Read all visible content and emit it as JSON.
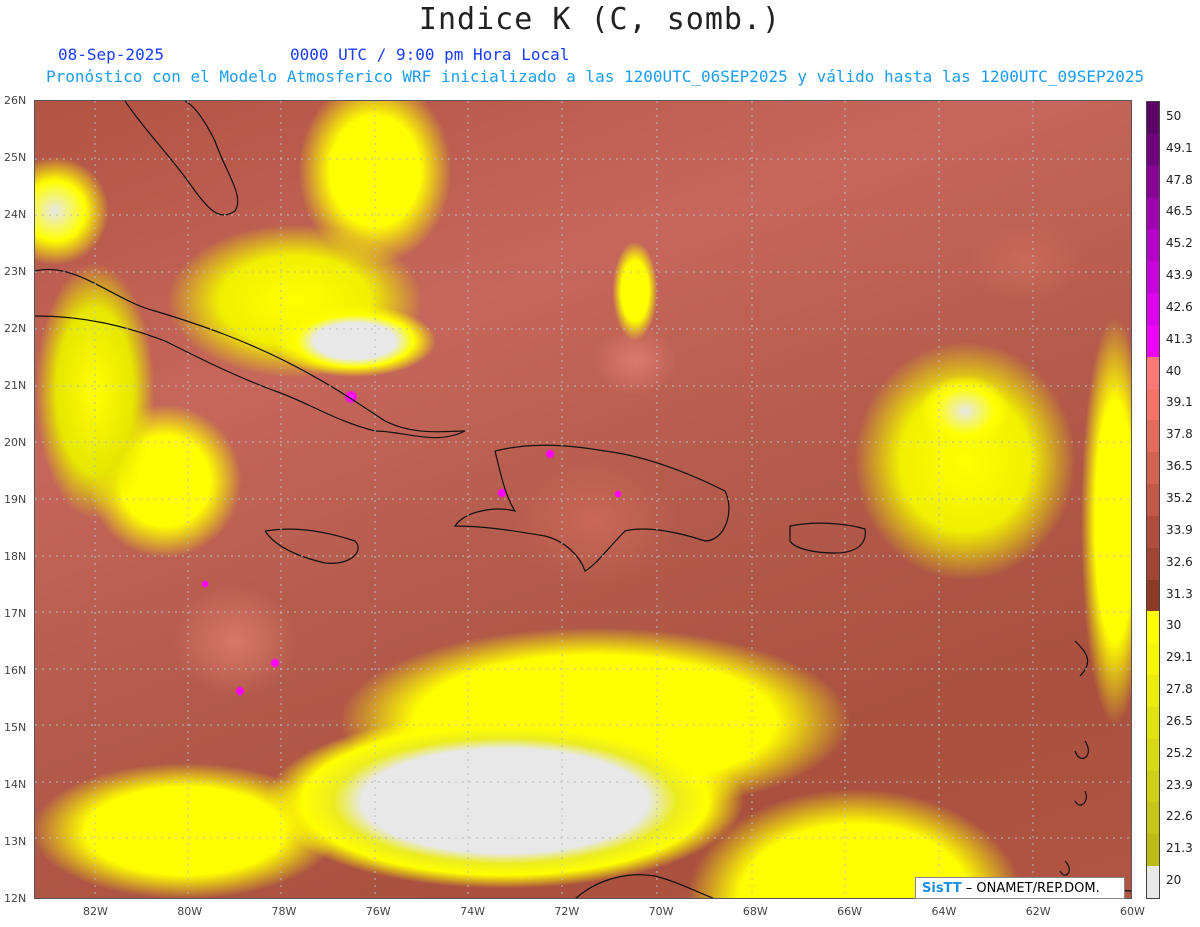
{
  "header": {
    "title": "Indice K (C, somb.)",
    "date": "08-Sep-2025",
    "time": "0000 UTC / 9:00 pm Hora Local",
    "model_line": "Pronóstico con el Modelo Atmosferico WRF inicializado a las 1200UTC_06SEP2025 y válido hasta las  1200UTC_09SEP2025"
  },
  "axes": {
    "lat_labels": [
      "26N",
      "25N",
      "24N",
      "23N",
      "22N",
      "21N",
      "20N",
      "19N",
      "18N",
      "17N",
      "16N",
      "15N",
      "14N",
      "13N",
      "12N"
    ],
    "lon_labels": [
      "82W",
      "80W",
      "78W",
      "76W",
      "74W",
      "72W",
      "70W",
      "68W",
      "66W",
      "64W",
      "62W",
      "60W"
    ]
  },
  "colorbar": {
    "labels": [
      "50",
      "49.1",
      "47.8",
      "46.5",
      "45.2",
      "43.9",
      "42.6",
      "41.3",
      "40",
      "39.1",
      "37.8",
      "36.5",
      "35.2",
      "33.9",
      "32.6",
      "31.3",
      "30",
      "29.1",
      "27.8",
      "26.5",
      "25.2",
      "23.9",
      "22.6",
      "21.3",
      "20"
    ],
    "colors": [
      "#5a0066",
      "#70007e",
      "#8a0096",
      "#a000b0",
      "#b400c8",
      "#c800dc",
      "#dc00f0",
      "#f000ff",
      "#ff7777",
      "#f77268",
      "#e56a5e",
      "#d46252",
      "#c35849",
      "#b24d3e",
      "#a04433",
      "#8c3a26",
      "#ffff00",
      "#f6f600",
      "#ecec0a",
      "#e2e20f",
      "#d8d814",
      "#cfcf16",
      "#c6c618",
      "#bcbc14",
      "#e8e8e8"
    ]
  },
  "credit": {
    "brand": "SisTT",
    "text": " – ONAMET/REP.DOM."
  }
}
